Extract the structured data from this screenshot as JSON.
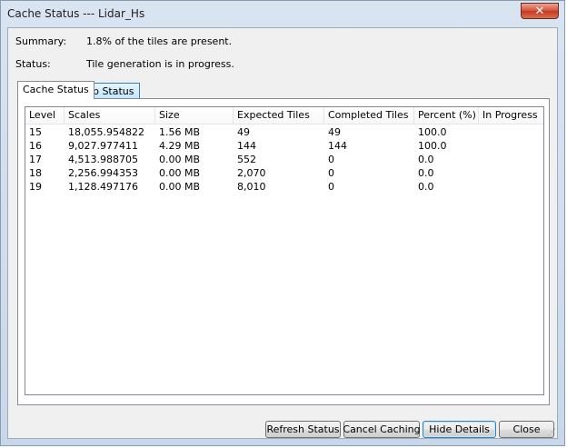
{
  "window": {
    "title": "Cache Status --- Lidar_Hs",
    "close_glyph": "✕"
  },
  "summary": {
    "label": "Summary:",
    "value": "1.8% of the tiles are present."
  },
  "status": {
    "label": "Status:",
    "value": "Tile generation is in progress."
  },
  "tabs": [
    {
      "label": "Cache Status",
      "active": true
    },
    {
      "label": "Job Status",
      "active": false
    }
  ],
  "table": {
    "columns": [
      "Level",
      "Scales",
      "Size",
      "Expected Tiles",
      "Completed Tiles",
      "Percent (%)",
      "In Progress"
    ],
    "rows": [
      [
        "15",
        "18,055.954822",
        "1.56 MB",
        "49",
        "49",
        "100.0",
        ""
      ],
      [
        "16",
        "9,027.977411",
        "4.29 MB",
        "144",
        "144",
        "100.0",
        ""
      ],
      [
        "17",
        "4,513.988705",
        "0.00 MB",
        "552",
        "0",
        "0.0",
        ""
      ],
      [
        "18",
        "2,256.994353",
        "0.00 MB",
        "2,070",
        "0",
        "0.0",
        ""
      ],
      [
        "19",
        "1,128.497176",
        "0.00 MB",
        "8,010",
        "0",
        "0.0",
        ""
      ]
    ]
  },
  "buttons": {
    "refresh": "Refresh Status",
    "cancel": "Cancel Caching",
    "hide_details": "Hide Details",
    "close": "Close"
  },
  "colors": {
    "close_button": "#c23a22",
    "tab_inactive": "#bee6fd",
    "default_button_border": "#3c7fb1"
  }
}
